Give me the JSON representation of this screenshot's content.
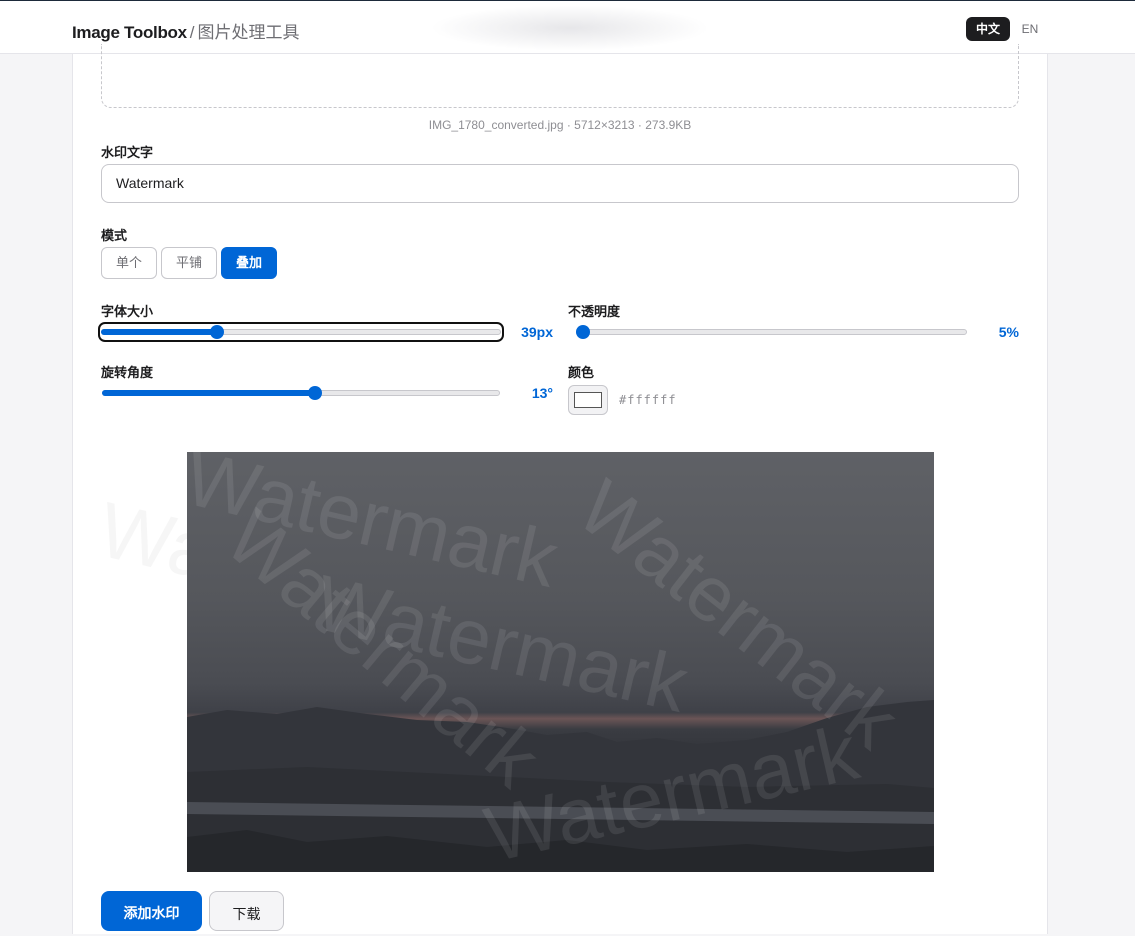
{
  "header": {
    "app_name": "Image Toolbox",
    "separator": "/",
    "subtitle": "图片处理工具",
    "lang_zh": "中文",
    "lang_en": "EN"
  },
  "file": {
    "info": "IMG_1780_converted.jpg · 5712×3213 · 273.9KB"
  },
  "watermark_text": {
    "label": "水印文字",
    "value": "Watermark"
  },
  "mode": {
    "label": "模式",
    "options": [
      "单个",
      "平铺",
      "叠加"
    ],
    "selected": "叠加"
  },
  "font_size": {
    "label": "字体大小",
    "value_text": "39px",
    "level": 0.29
  },
  "opacity": {
    "label": "不透明度",
    "value_text": "5%",
    "level": 0.0
  },
  "rotation": {
    "label": "旋转角度",
    "value_text": "13°",
    "level": 0.535
  },
  "color": {
    "label": "颜色",
    "hex": "#ffffff"
  },
  "preview": {
    "watermark_word": "Watermark"
  },
  "actions": {
    "apply_label": "添加水印",
    "download_label": "下载"
  },
  "colors": {
    "accent": "#0066d6",
    "dark": "#1d1d1f"
  }
}
